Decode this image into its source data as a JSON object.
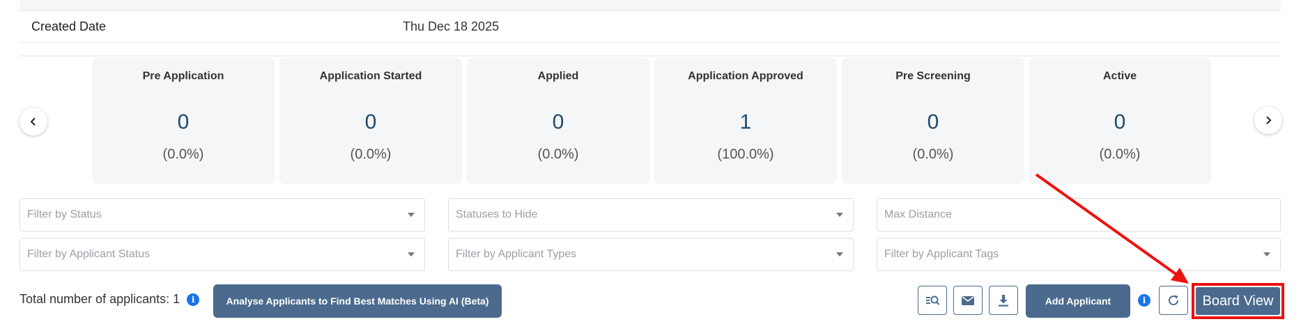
{
  "details": {
    "created_date_label": "Created Date",
    "created_date_value": "Thu Dec 18 2025"
  },
  "pipeline_cards": [
    {
      "title": "Pre Application",
      "count": "0",
      "percent": "(0.0%)"
    },
    {
      "title": "Application Started",
      "count": "0",
      "percent": "(0.0%)"
    },
    {
      "title": "Applied",
      "count": "0",
      "percent": "(0.0%)"
    },
    {
      "title": "Application Approved",
      "count": "1",
      "percent": "(100.0%)"
    },
    {
      "title": "Pre Screening",
      "count": "0",
      "percent": "(0.0%)"
    },
    {
      "title": "Active",
      "count": "0",
      "percent": "(0.0%)"
    }
  ],
  "filters": {
    "status_placeholder": "Filter by Status",
    "hide_statuses_placeholder": "Statuses to Hide",
    "max_distance_placeholder": "Max Distance",
    "applicant_status_placeholder": "Filter by Applicant Status",
    "applicant_types_placeholder": "Filter by Applicant Types",
    "applicant_tags_placeholder": "Filter by Applicant Tags"
  },
  "footer": {
    "total_label": "Total number of applicants: 1",
    "info_glyph": "i",
    "analyse_button_label": "Analyse Applicants to Find Best Matches Using AI (Beta)",
    "add_applicant_label": "Add Applicant",
    "board_view_label": "Board View"
  },
  "icons": [
    "chevron-left-icon",
    "chevron-right-icon",
    "search-list-icon",
    "mail-icon",
    "download-icon",
    "info-icon",
    "refresh-icon"
  ],
  "colors": {
    "primary": "#4b6a8d",
    "count_text": "#1e4a70",
    "info_blue": "#1a73e8",
    "highlight_red": "#ee1111",
    "card_bg": "#f5f6f8"
  }
}
